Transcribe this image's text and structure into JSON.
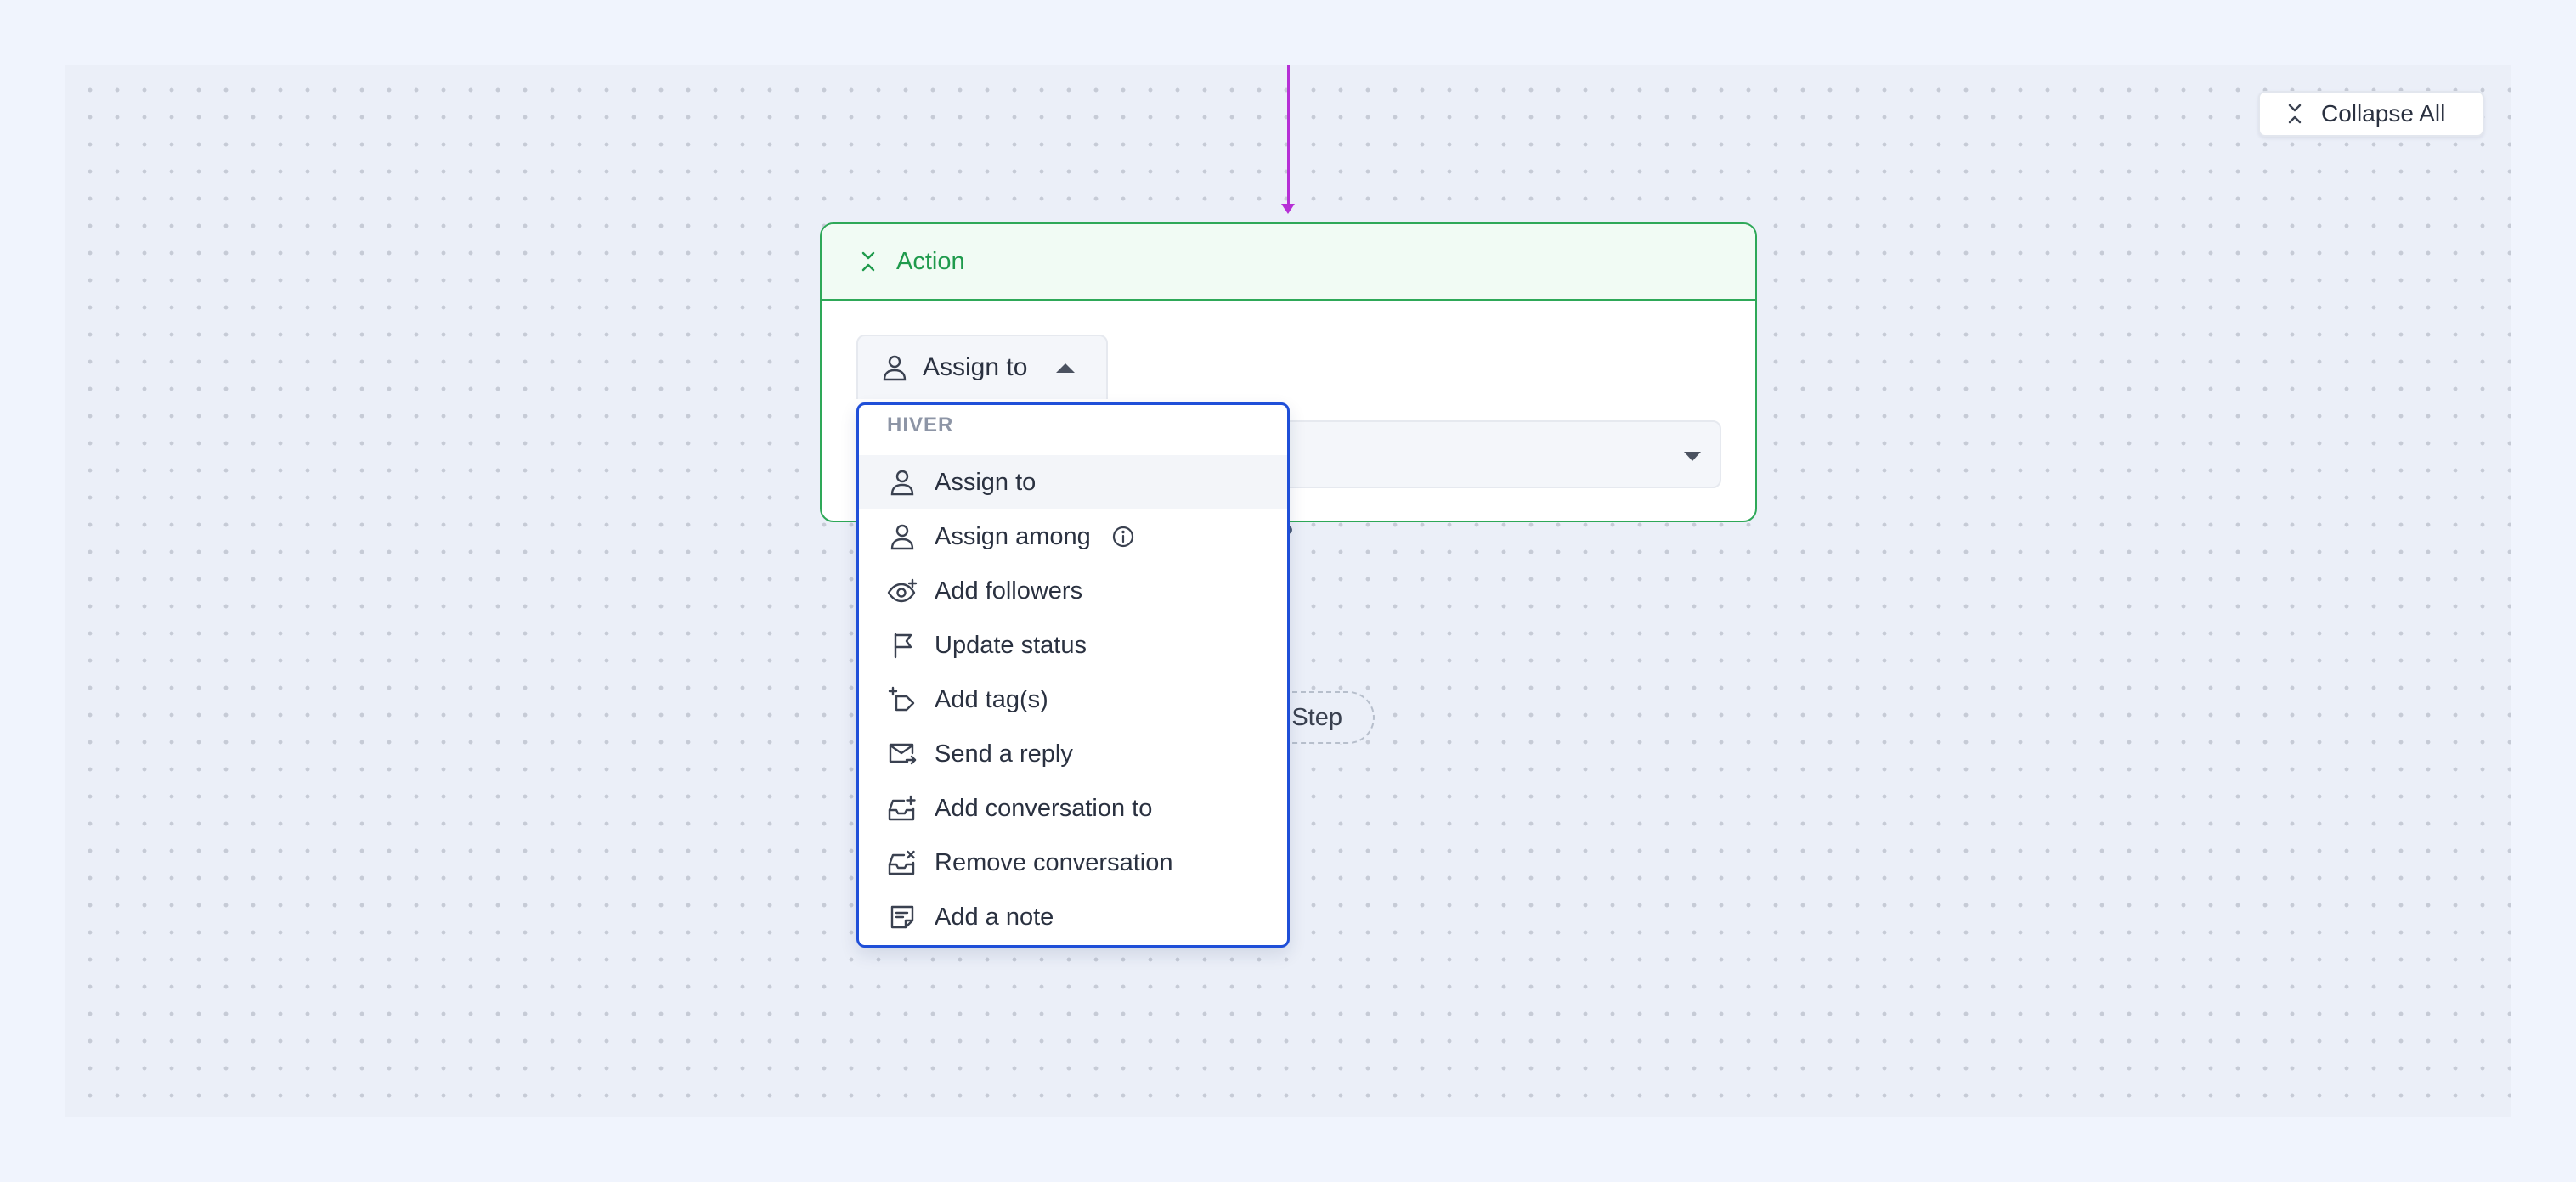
{
  "toolbar": {
    "collapse_all_label": "Collapse All"
  },
  "action_card": {
    "title": "Action",
    "selected_action": "Assign to"
  },
  "add_step": {
    "label": "Step"
  },
  "dropdown": {
    "group_label": "HIVER",
    "items": [
      {
        "label": "Assign to",
        "icon": "user-icon",
        "selected": true
      },
      {
        "label": "Assign among",
        "icon": "user-icon",
        "info": true
      },
      {
        "label": "Add followers",
        "icon": "eye-plus-icon"
      },
      {
        "label": "Update status",
        "icon": "flag-icon"
      },
      {
        "label": "Add tag(s)",
        "icon": "tag-plus-icon"
      },
      {
        "label": "Send a reply",
        "icon": "mail-send-icon"
      },
      {
        "label": "Add conversation to",
        "icon": "inbox-plus-icon"
      },
      {
        "label": "Remove conversation",
        "icon": "inbox-remove-icon"
      },
      {
        "label": "Add a note",
        "icon": "note-icon"
      }
    ]
  },
  "colors": {
    "accent_green": "#2ea858",
    "connector_purple": "#b62fd6",
    "dropdown_border": "#1f4fd8"
  }
}
